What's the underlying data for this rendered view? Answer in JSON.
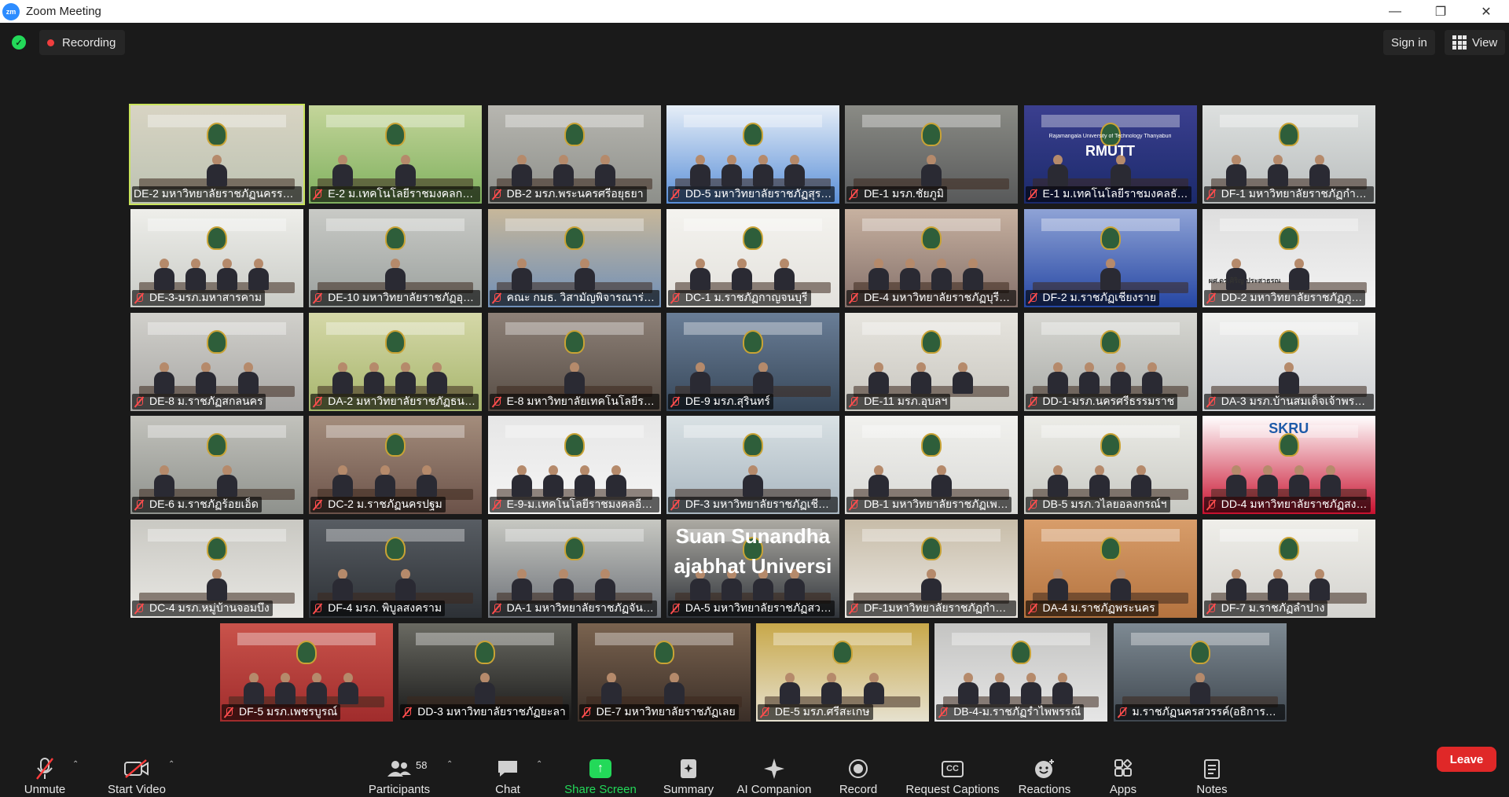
{
  "window": {
    "title": "Zoom Meeting",
    "app_icon": "zoom-logo",
    "controls": [
      "minimize",
      "restore",
      "close"
    ]
  },
  "topbar": {
    "recording_label": "Recording",
    "signin_label": "Sign in",
    "view_label": "View"
  },
  "gallery": {
    "rows": [
      [
        "DE-2 มหาวิทยาลัยราชภัฏนครรา…",
        "E-2 ม.เทคโนโลยีราชมงคลกรุ…",
        "DB-2 มรภ.พระนครศรีอยุธยา",
        "DD-5 มหาวิทยาลัยราชภัฏสุร…",
        "DE-1 มรภ.ชัยภูมิ",
        "E-1 ม.เทคโนโลยีราชมงคลธั…",
        "DF-1 มหาวิทยาลัยราชภัฏกำแ…"
      ],
      [
        "DE-3-มรภ.มหาสารคาม",
        "DE-10 มหาวิทยาลัยราชภัฏอุดรธ…",
        "คณะ กมธ. วิสามัญพิจารณาร่าง พ…",
        "DC-1 ม.ราชภัฏกาญจนบุรี",
        "DE-4 มหาวิทยาลัยราชภัฏบุรีรั…",
        "DF-2 ม.ราชภัฏเชียงราย",
        "DD-2 มหาวิทยาลัยราชภัฏภู…"
      ],
      [
        "DE-8 ม.ราชภัฏสกลนคร",
        "DA-2 มหาวิทยาลัยราชภัฏธน…",
        "E-8 มหาวิทยาลัยเทคโนโลยีรา…",
        "DE-9 มรภ.สุรินทร์",
        "DE-11 มรภ.อุบลฯ",
        "DD-1-มรภ.นครศรีธรรมราช",
        "DA-3 มรภ.บ้านสมเด็จเจ้าพระ…"
      ],
      [
        "DE-6 ม.ราชภัฏร้อยเอ็ด",
        "DC-2 ม.ราชภัฏนครปฐม",
        "E-9-ม.เทคโนโลยีราชมงคลอีส…",
        "DF-3 มหาวิทยาลัยราชภัฏเชียงใหม่",
        "DB-1 มหาวิทยาลัยราชภัฏเพ…",
        "DB-5 มรภ.วไลยอลงกรณ์ฯ",
        "DD-4 มหาวิทยาลัยราชภัฏสง…"
      ],
      [
        "DC-4 มรภ.หมู่บ้านจอมบึง",
        "DF-4 มรภ. พิบูลสงคราม",
        "DA-1 มหาวิทยาลัยราชภัฏจัน…",
        "DA-5 มหาวิทยาลัยราชภัฏสว…",
        "DF-1มหาวิทยาลัยราชภัฏกำแ…",
        "DA-4 ม.ราชภัฏพระนคร",
        "DF-7 ม.ราชภัฏลำปาง"
      ],
      [
        "DF-5 มรภ.เพชรบูรณ์",
        "DD-3 มหาวิทยาลัยราชภัฏยะลา",
        "DE-7 มหาวิทยาลัยราชภัฏเลย",
        "DE-5 มรภ.ศรีสะเกษ",
        "DB-4-ม.ราชภัฏรำไพพรรณี",
        "ม.ราชภัฏนครสวรรค์(อธิการบดี)"
      ]
    ],
    "tile_texts": {
      "r0c5": "RMUTT",
      "r0c5_sub": "Rajamangala University of Technology Thanyaburi",
      "r3c6": "SKRU",
      "r4c3": "Suan Sunandha",
      "r4c3_b": "ajabhat Universi",
      "r1c6": "ผศ.ดร.ศิริญ ประสาธรณ"
    }
  },
  "toolbar": {
    "unmute": "Unmute",
    "start_video": "Start Video",
    "participants": "Participants",
    "participants_count": "58",
    "chat": "Chat",
    "share_screen": "Share Screen",
    "summary": "Summary",
    "ai_companion": "AI Companion",
    "record": "Record",
    "captions": "Request Captions",
    "captions_icon_text": "CC",
    "reactions": "Reactions",
    "apps": "Apps",
    "notes": "Notes",
    "leave": "Leave",
    "accent_share": "#23d959",
    "accent_leave": "#e02828"
  }
}
